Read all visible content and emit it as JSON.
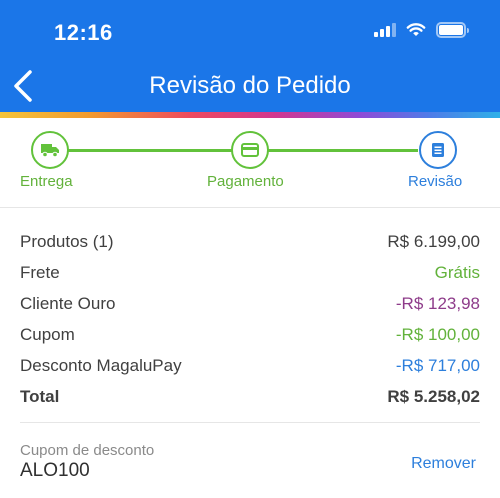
{
  "status_bar": {
    "time": "12:16"
  },
  "nav": {
    "title": "Revisão do Pedido"
  },
  "steps": [
    {
      "label": "Entrega",
      "icon": "truck-icon",
      "state": "done"
    },
    {
      "label": "Pagamento",
      "icon": "credit-card-icon",
      "state": "done"
    },
    {
      "label": "Revisão",
      "icon": "document-icon",
      "state": "current"
    }
  ],
  "summary": {
    "rows": [
      {
        "label": "Produtos (1)",
        "value": "R$ 6.199,00",
        "color": "#404040"
      },
      {
        "label": "Frete",
        "value": "Grátis",
        "color": "#62b23b"
      },
      {
        "label": "Cliente Ouro",
        "value": "-R$ 123,98",
        "color": "#8e3c8a"
      },
      {
        "label": "Cupom",
        "value": "-R$ 100,00",
        "color": "#62b23b"
      },
      {
        "label": "Desconto MagaluPay",
        "value": "-R$ 717,00",
        "color": "#2d7fdc"
      }
    ],
    "total": {
      "label": "Total",
      "value": "R$ 5.258,02"
    }
  },
  "coupon": {
    "caption": "Cupom de desconto",
    "code": "ALO100",
    "remove_label": "Remover"
  },
  "colors": {
    "header_blue": "#1b76e8",
    "step_green": "#62c23b",
    "step_active_blue": "#2d7fdc"
  }
}
